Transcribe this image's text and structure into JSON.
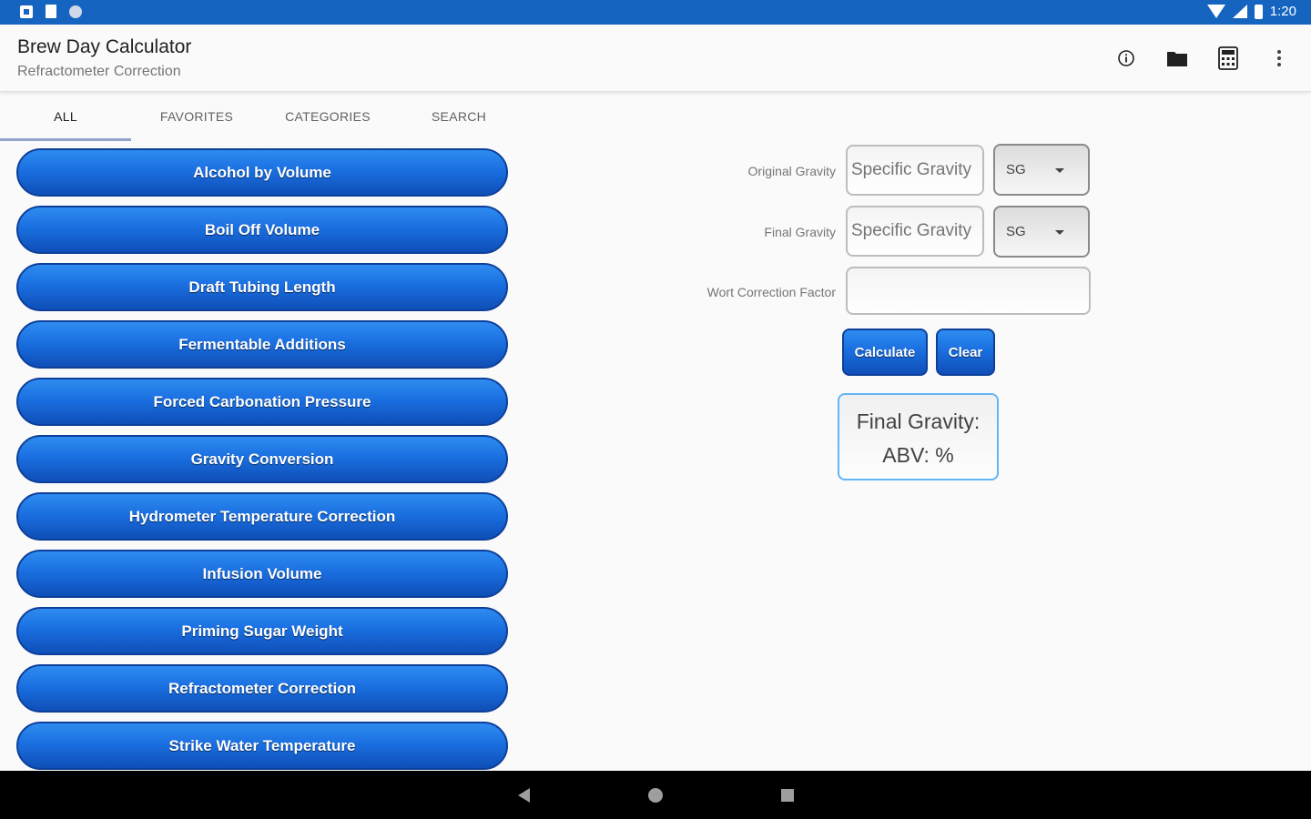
{
  "status_bar": {
    "time": "1:20"
  },
  "app_bar": {
    "title": "Brew Day Calculator",
    "subtitle": "Refractometer Correction",
    "actions": [
      "info-icon",
      "folder-icon",
      "calculator-icon",
      "more-vert-icon"
    ]
  },
  "tabs": [
    {
      "label": "ALL",
      "active": true
    },
    {
      "label": "FAVORITES",
      "active": false
    },
    {
      "label": "CATEGORIES",
      "active": false
    },
    {
      "label": "SEARCH",
      "active": false
    }
  ],
  "calculators": [
    "Alcohol by Volume",
    "Boil Off Volume",
    "Draft Tubing Length",
    "Fermentable Additions",
    "Forced Carbonation Pressure",
    "Gravity Conversion",
    "Hydrometer Temperature Correction",
    "Infusion Volume",
    "Priming Sugar Weight",
    "Refractometer Correction",
    "Strike Water Temperature"
  ],
  "form": {
    "original_gravity": {
      "label": "Original Gravity",
      "value": "",
      "placeholder": "Specific Gravity",
      "unit": "SG"
    },
    "final_gravity": {
      "label": "Final Gravity",
      "value": "",
      "placeholder": "Specific Gravity",
      "unit": "SG"
    },
    "wort_correction": {
      "label": "Wort Correction Factor",
      "value": "",
      "placeholder": ""
    },
    "calculate_label": "Calculate",
    "clear_label": "Clear"
  },
  "result": {
    "line1": "Final Gravity:",
    "line2": "ABV: %"
  },
  "colors": {
    "status_bar": "#1565c0",
    "button_blue": "#1a6fe0",
    "button_border": "#0d3f9a",
    "result_border": "#64b5f6"
  }
}
